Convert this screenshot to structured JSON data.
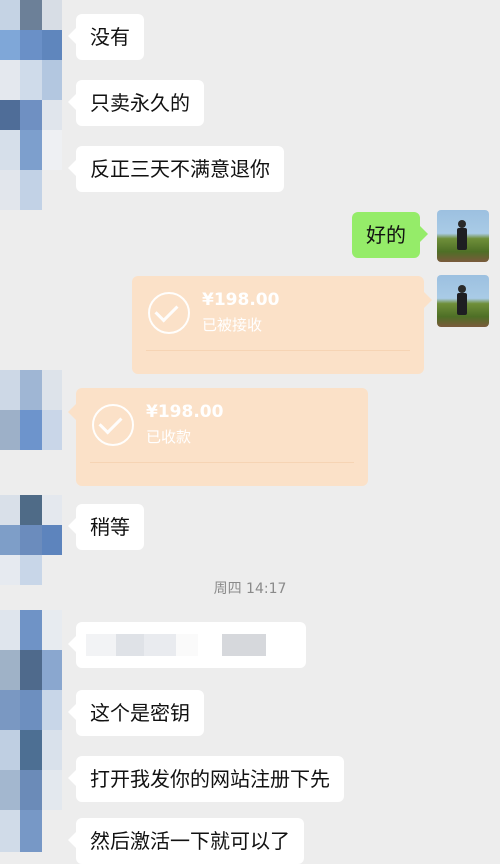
{
  "messages": {
    "m1": "没有",
    "m2": "只卖永久的",
    "m3": "反正三天不满意退你",
    "m4_self": "好的",
    "m5": "稍等",
    "m6": "这个是密钥",
    "m7": "打开我发你的网站注册下先",
    "m8": "然后激活一下就可以了"
  },
  "transfers": {
    "sent": {
      "amount": "¥198.00",
      "status": "已被接收"
    },
    "received": {
      "amount": "¥198.00",
      "status": "已收款"
    }
  },
  "timestamp": "周四 14:17",
  "colors": {
    "background": "#ededed",
    "bubble_other": "#ffffff",
    "bubble_self": "#95ec69",
    "transfer": "#fbe1c8",
    "timestamp_text": "#8a8a8a"
  },
  "icons": {
    "transfer_status": "check-circle-icon",
    "contact_avatar": "pixelated-avatar",
    "self_avatar": "photo-avatar"
  }
}
